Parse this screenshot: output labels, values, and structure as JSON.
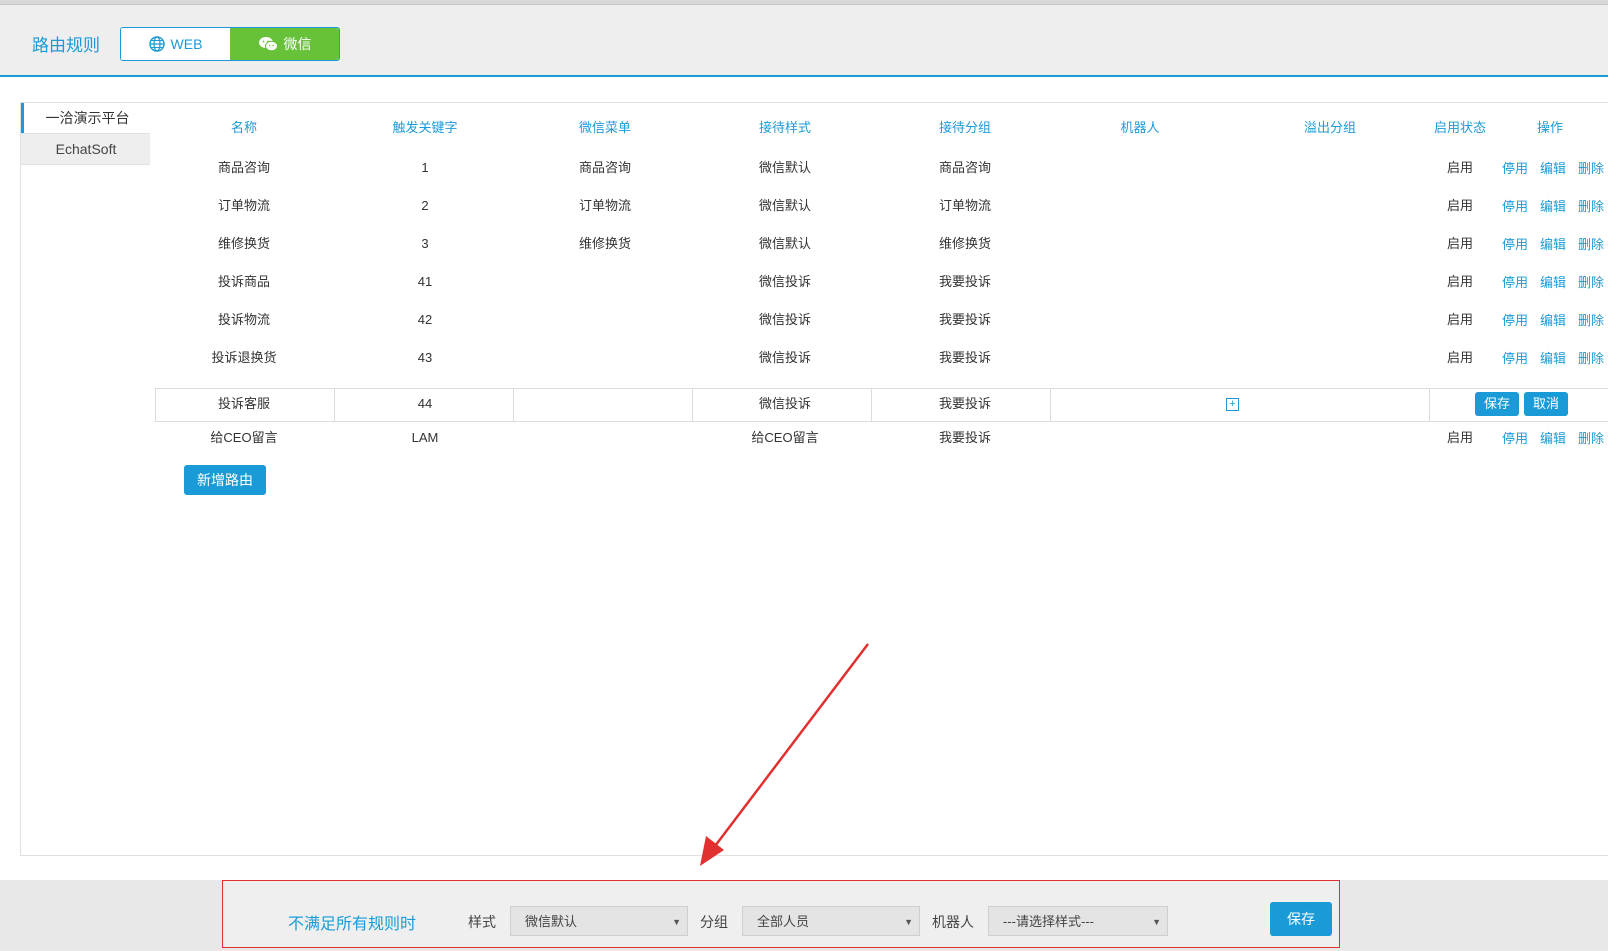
{
  "header": {
    "title": "路由规则",
    "tabs": [
      {
        "label": "WEB",
        "icon": "globe-icon"
      },
      {
        "label": "微信",
        "icon": "wechat-icon"
      }
    ],
    "active_color": "#67c23a",
    "accent_color": "#1a9bd7"
  },
  "sidebar": {
    "items": [
      {
        "label": "一洽演示平台",
        "active": true
      },
      {
        "label": "EchatSoft",
        "active": false
      }
    ]
  },
  "table": {
    "headers": [
      "名称",
      "触发关键字",
      "微信菜单",
      "接待样式",
      "接待分组",
      "机器人",
      "溢出分组",
      "启用状态",
      "操作"
    ],
    "rows": [
      {
        "name": "商品咨询",
        "keyword": "1",
        "menu": "商品咨询",
        "style": "微信默认",
        "group": "商品咨询",
        "robot": "",
        "overflow": "",
        "status": "启用"
      },
      {
        "name": "订单物流",
        "keyword": "2",
        "menu": "订单物流",
        "style": "微信默认",
        "group": "订单物流",
        "robot": "",
        "overflow": "",
        "status": "启用"
      },
      {
        "name": "维修换货",
        "keyword": "3",
        "menu": "维修换货",
        "style": "微信默认",
        "group": "维修换货",
        "robot": "",
        "overflow": "",
        "status": "启用"
      },
      {
        "name": "投诉商品",
        "keyword": "41",
        "menu": "",
        "style": "微信投诉",
        "group": "我要投诉",
        "robot": "",
        "overflow": "",
        "status": "启用"
      },
      {
        "name": "投诉物流",
        "keyword": "42",
        "menu": "",
        "style": "微信投诉",
        "group": "我要投诉",
        "robot": "",
        "overflow": "",
        "status": "启用"
      },
      {
        "name": "投诉退换货",
        "keyword": "43",
        "menu": "",
        "style": "微信投诉",
        "group": "我要投诉",
        "robot": "",
        "overflow": "",
        "status": "启用"
      }
    ],
    "edit_row": {
      "name": "投诉客服",
      "keyword": "44",
      "menu": "",
      "style": "微信投诉",
      "group": "我要投诉",
      "save_label": "保存",
      "cancel_label": "取消"
    },
    "last_row": {
      "name": "给CEO留言",
      "keyword": "LAM",
      "menu": "",
      "style": "给CEO留言",
      "group": "我要投诉",
      "status": "启用"
    },
    "actions": {
      "disable": "停用",
      "edit": "编辑",
      "delete": "删除"
    },
    "add_button": "新增路由"
  },
  "footer": {
    "title": "不满足所有规则时",
    "style_label": "样式",
    "style_value": "微信默认",
    "group_label": "分组",
    "group_value": "全部人员",
    "robot_label": "机器人",
    "robot_value": "---请选择样式---",
    "save_label": "保存",
    "highlight_color": "#e03030"
  }
}
